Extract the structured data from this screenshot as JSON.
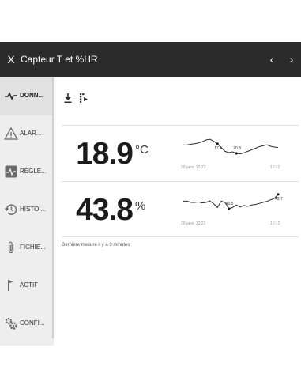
{
  "header": {
    "close_glyph": "X",
    "title": "Capteur T et %HR",
    "prev_glyph": "‹",
    "next_glyph": "›",
    "background": "#2b2b2b"
  },
  "sidebar": {
    "items": [
      {
        "label": "DONN...",
        "icon": "activity-icon",
        "active": true
      },
      {
        "label": "ALAR...",
        "icon": "warning-icon",
        "active": false
      },
      {
        "label": "RÈGLE...",
        "icon": "settings-pulse-icon",
        "active": false
      },
      {
        "label": "HISTOI...",
        "icon": "history-icon",
        "active": false
      },
      {
        "label": "FICHIE...",
        "icon": "paperclip-icon",
        "active": false
      },
      {
        "label": "ACTIF",
        "icon": "flag-icon",
        "active": false
      },
      {
        "label": "CONFI...",
        "icon": "cogs-icon",
        "active": false
      }
    ]
  },
  "toolbar": {
    "download_icon": "download-icon",
    "export_icon": "export-icon"
  },
  "cards": [
    {
      "name": "temperature",
      "value": "18.9",
      "unit": "°C",
      "chart": {
        "start_label": "20-janv. 10:23",
        "end_label": "10:12",
        "max_label": "20.8",
        "min_label": "17.4",
        "series": [
          0.55,
          0.55,
          0.58,
          0.6,
          0.63,
          0.68,
          0.75,
          0.78,
          0.7,
          0.6,
          0.45,
          0.3,
          0.25,
          0.28,
          0.22,
          0.2,
          0.24,
          0.3,
          0.36,
          0.42,
          0.48,
          0.52,
          0.56,
          0.5,
          0.47,
          0.45
        ],
        "max_index": 14,
        "min_index": 9
      }
    },
    {
      "name": "humidity",
      "value": "43.8",
      "unit": "%",
      "chart": {
        "start_label": "20-janv. 10:23",
        "end_label": "10:12",
        "max_label": "43.5",
        "min_label": "43.7",
        "series": [
          0.55,
          0.55,
          0.5,
          0.5,
          0.52,
          0.48,
          0.5,
          0.56,
          0.45,
          0.3,
          0.55,
          0.5,
          0.25,
          0.3,
          0.4,
          0.32,
          0.38,
          0.34,
          0.4,
          0.42,
          0.46,
          0.5,
          0.54,
          0.6,
          0.66,
          0.82
        ],
        "max_index": 12,
        "min_index": 25
      }
    }
  ],
  "status": {
    "text": "Dernière mesure il y a 3 minutes"
  }
}
